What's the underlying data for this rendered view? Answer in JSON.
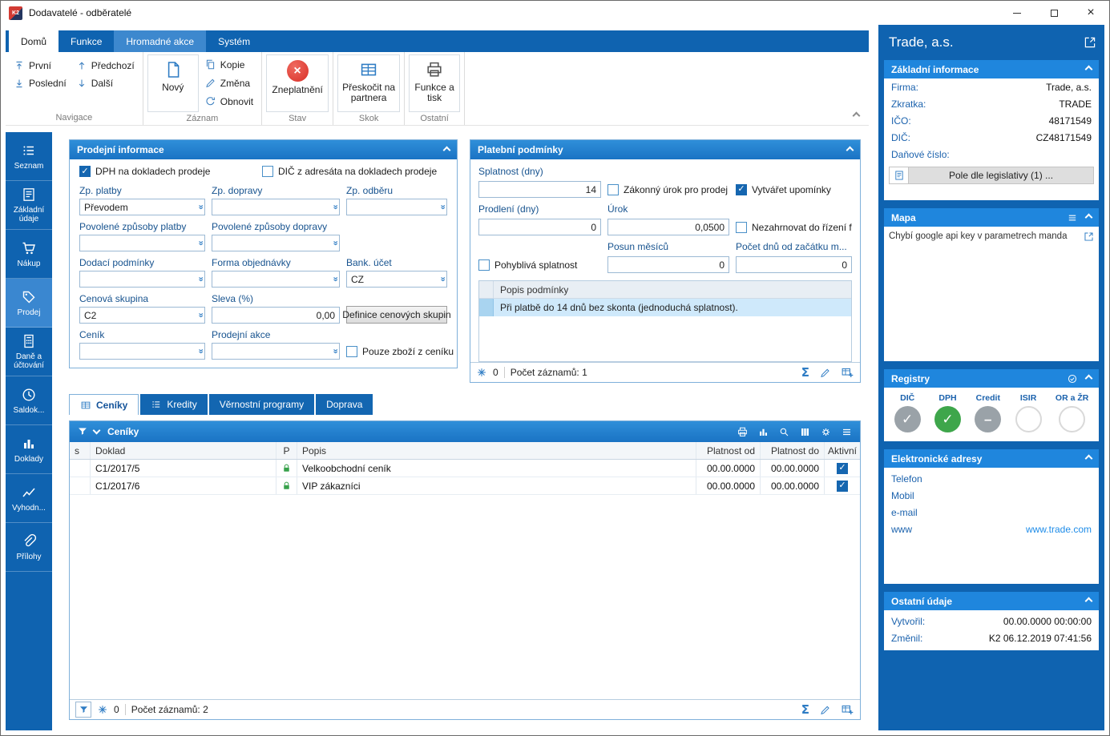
{
  "window": {
    "title": "Dodavatelé - odběratelé"
  },
  "ribbon": {
    "tabs": [
      {
        "label": "Domů"
      },
      {
        "label": "Funkce"
      },
      {
        "label": "Hromadné akce"
      },
      {
        "label": "Systém"
      }
    ],
    "nav": {
      "first": "První",
      "last": "Poslední",
      "prev": "Předchozí",
      "next": "Další",
      "group": "Navigace"
    },
    "record": {
      "new": "Nový",
      "copy": "Kopie",
      "change": "Změna",
      "restore": "Obnovit",
      "group": "Záznam"
    },
    "state": {
      "invalidate": "Zneplatnění",
      "group": "Stav"
    },
    "jump": {
      "label": "Přeskočit na partnera",
      "group": "Skok"
    },
    "other": {
      "label": "Funkce a tisk",
      "group": "Ostatní"
    }
  },
  "sidebar": {
    "items": [
      {
        "label": "Seznam"
      },
      {
        "label": "Základní údaje"
      },
      {
        "label": "Nákup"
      },
      {
        "label": "Prodej"
      },
      {
        "label": "Daně a účtování"
      },
      {
        "label": "Saldok..."
      },
      {
        "label": "Doklady"
      },
      {
        "label": "Vyhodn..."
      },
      {
        "label": "Přílohy"
      }
    ],
    "active": "Prodej"
  },
  "sales_info": {
    "title": "Prodejní informace",
    "cb_dph": {
      "label": "DPH na dokladech prodeje",
      "checked": true
    },
    "cb_dic": {
      "label": "DIČ z adresáta na dokladech prodeje",
      "checked": false
    },
    "zp_platby": {
      "label": "Zp. platby",
      "value": "Převodem"
    },
    "zp_dopravy": {
      "label": "Zp. dopravy",
      "value": ""
    },
    "zp_odberu": {
      "label": "Zp. odběru",
      "value": ""
    },
    "povolene_platby": {
      "label": "Povolené způsoby platby",
      "value": ""
    },
    "povolene_dopravy": {
      "label": "Povolené způsoby dopravy",
      "value": ""
    },
    "dodaci": {
      "label": "Dodací podmínky",
      "value": ""
    },
    "forma": {
      "label": "Forma objednávky",
      "value": ""
    },
    "bank": {
      "label": "Bank. účet",
      "value": "CZ"
    },
    "cenova_skupina": {
      "label": "Cenová skupina",
      "value": "C2"
    },
    "sleva": {
      "label": "Sleva (%)",
      "value": "0,00"
    },
    "definice_btn": "Definice cenových skupin",
    "cenik": {
      "label": "Ceník",
      "value": ""
    },
    "akce": {
      "label": "Prodejní akce",
      "value": ""
    },
    "cb_pouze": {
      "label": "Pouze zboží z ceníku",
      "checked": false
    }
  },
  "payment_terms": {
    "title": "Platební podmínky",
    "splatnost": {
      "label": "Splatnost (dny)",
      "value": "14"
    },
    "cb_urok": {
      "label": "Zákonný úrok pro prodej",
      "checked": false
    },
    "cb_upominky": {
      "label": "Vytvářet upomínky",
      "checked": true
    },
    "prodleni": {
      "label": "Prodlení (dny)",
      "value": "0"
    },
    "urok": {
      "label": "Úrok",
      "value": "0,0500"
    },
    "cb_nezahrnovat": {
      "label": "Nezahrnovat do řízení f...",
      "checked": false
    },
    "cb_pohybliva": {
      "label": "Pohyblivá splatnost",
      "checked": false
    },
    "posun": {
      "label": "Posun měsíců",
      "value": "0"
    },
    "pocet_dnu": {
      "label": "Počet dnů od začátku m...",
      "value": "0"
    },
    "grid_header": "Popis podmínky",
    "grid_row": "Při platbě do 14 dnů bez skonta (jednoduchá splatnost).",
    "footer": {
      "count": "0",
      "records": "Počet záznamů: 1"
    }
  },
  "detail_tabs": [
    {
      "label": "Ceníky"
    },
    {
      "label": "Kredity"
    },
    {
      "label": "Věrnostní programy"
    },
    {
      "label": "Doprava"
    }
  ],
  "pricelists": {
    "title": "Ceníky",
    "columns": [
      "s",
      "Doklad",
      "P",
      "Popis",
      "Platnost od",
      "Platnost do",
      "Aktivní"
    ],
    "rows": [
      {
        "doklad": "C1/2017/5",
        "popis": "Velkoobchodní ceník",
        "od": "00.00.0000",
        "do": "00.00.0000",
        "active": true
      },
      {
        "doklad": "C1/2017/6",
        "popis": "VIP zákazníci",
        "od": "00.00.0000",
        "do": "00.00.0000",
        "active": true
      }
    ],
    "footer": {
      "count": "0",
      "records": "Počet záznamů: 2"
    }
  },
  "right_panel": {
    "company": "Trade, a.s.",
    "basic": {
      "title": "Základní informace",
      "rows": [
        {
          "label": "Firma:",
          "value": "Trade, a.s."
        },
        {
          "label": "Zkratka:",
          "value": "TRADE"
        },
        {
          "label": "IČO:",
          "value": "48171549"
        },
        {
          "label": "DIČ:",
          "value": "CZ48171549"
        },
        {
          "label": "Daňové číslo:",
          "value": ""
        }
      ],
      "legislative_btn": "Pole dle legislativy (1) ..."
    },
    "map": {
      "title": "Mapa",
      "message": "Chybí google api key v parametrech manda"
    },
    "registry": {
      "title": "Registry",
      "items": [
        {
          "label": "DIČ",
          "state": "check-gray"
        },
        {
          "label": "DPH",
          "state": "check-green"
        },
        {
          "label": "Credit",
          "state": "minus-gray"
        },
        {
          "label": "ISIR",
          "state": "empty"
        },
        {
          "label": "OR a ŽR",
          "state": "empty"
        }
      ]
    },
    "contacts": {
      "title": "Elektronické adresy",
      "rows": [
        {
          "label": "Telefon",
          "value": ""
        },
        {
          "label": "Mobil",
          "value": ""
        },
        {
          "label": "e-mail",
          "value": ""
        },
        {
          "label": "www",
          "value": "www.trade.com"
        }
      ]
    },
    "other": {
      "title": "Ostatní údaje",
      "rows": [
        {
          "label": "Vytvořil:",
          "value": "00.00.0000 00:00:00"
        },
        {
          "label": "Změnil:",
          "value": "K2 06.12.2019 07:41:56"
        }
      ]
    }
  }
}
